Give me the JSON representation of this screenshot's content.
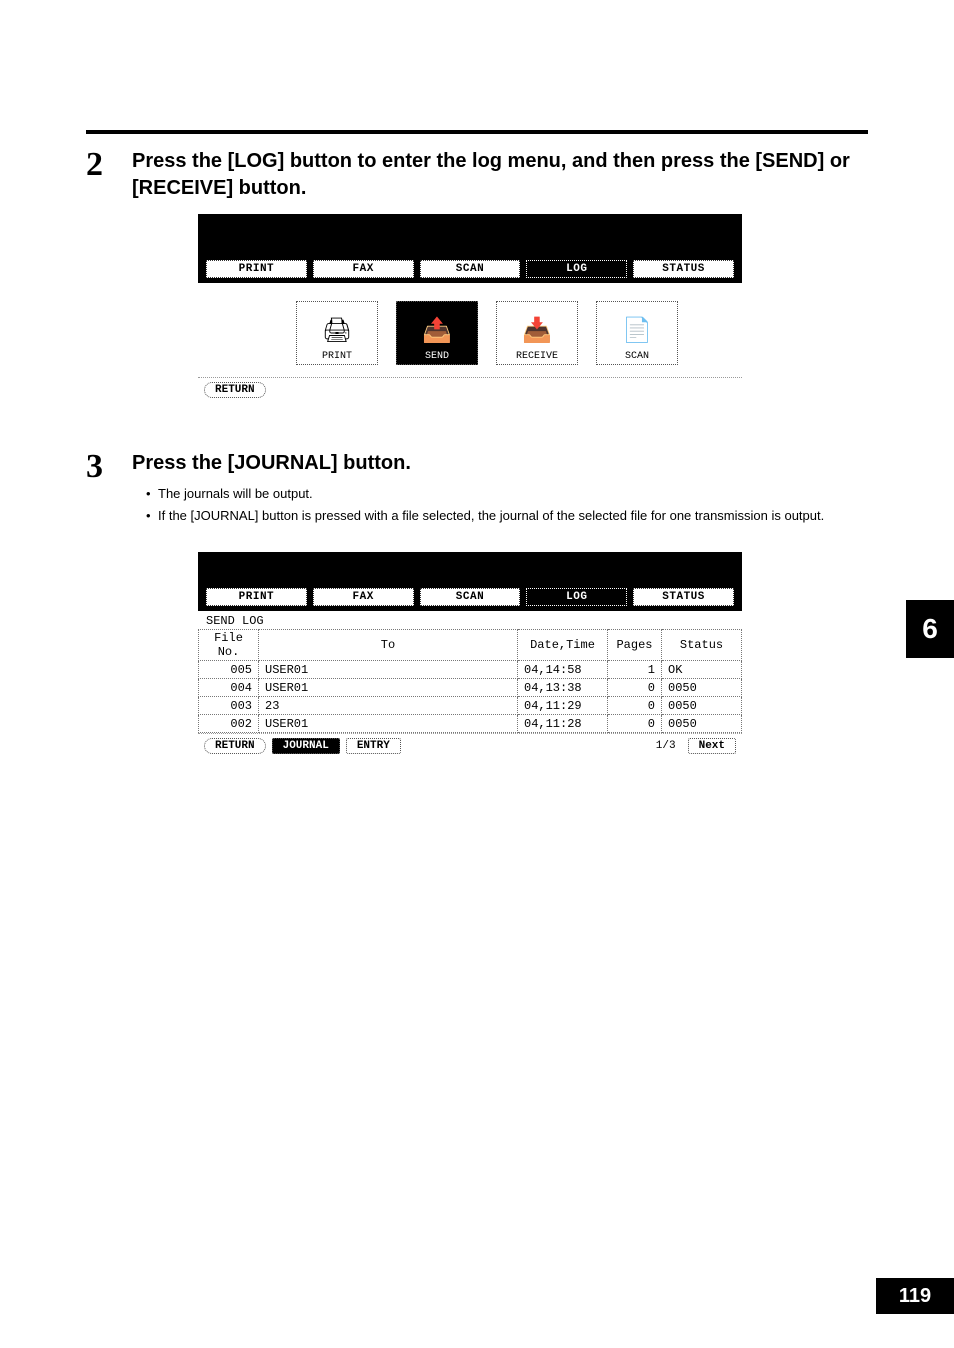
{
  "chapter_tab": "6",
  "page_number": "119",
  "step2": {
    "number": "2",
    "heading": "Press the [LOG] button to enter the log menu, and then press the [SEND] or [RECEIVE] button."
  },
  "step3": {
    "number": "3",
    "heading": "Press the [JOURNAL] button.",
    "bullets": [
      "The journals will be output.",
      "If the [JOURNAL] button is pressed with a file selected, the journal of the selected file for one transmission is output."
    ]
  },
  "screen1": {
    "tabs": [
      "PRINT",
      "FAX",
      "SCAN",
      "LOG",
      "STATUS"
    ],
    "active_tab": "LOG",
    "icons": [
      {
        "name": "print-icon",
        "label": "PRINT"
      },
      {
        "name": "send-icon",
        "label": "SEND"
      },
      {
        "name": "receive-icon",
        "label": "RECEIVE"
      },
      {
        "name": "scan-icon",
        "label": "SCAN"
      }
    ],
    "active_icon": "SEND",
    "return_label": "RETURN"
  },
  "screen2": {
    "tabs": [
      "PRINT",
      "FAX",
      "SCAN",
      "LOG",
      "STATUS"
    ],
    "active_tab": "LOG",
    "subheading": "SEND LOG",
    "columns": [
      "File No.",
      "To",
      "Date,Time",
      "Pages",
      "Status"
    ],
    "rows": [
      {
        "file": "005",
        "to": "USER01",
        "dt": "04,14:58",
        "pages": "1",
        "status": "OK"
      },
      {
        "file": "004",
        "to": "USER01",
        "dt": "04,13:38",
        "pages": "0",
        "status": "0050"
      },
      {
        "file": "003",
        "to": "23",
        "dt": "04,11:29",
        "pages": "0",
        "status": "0050"
      },
      {
        "file": "002",
        "to": "USER01",
        "dt": "04,11:28",
        "pages": "0",
        "status": "0050"
      }
    ],
    "buttons": {
      "return": "RETURN",
      "journal": "JOURNAL",
      "entry": "ENTRY",
      "next": "Next"
    },
    "pager": "1/3"
  }
}
